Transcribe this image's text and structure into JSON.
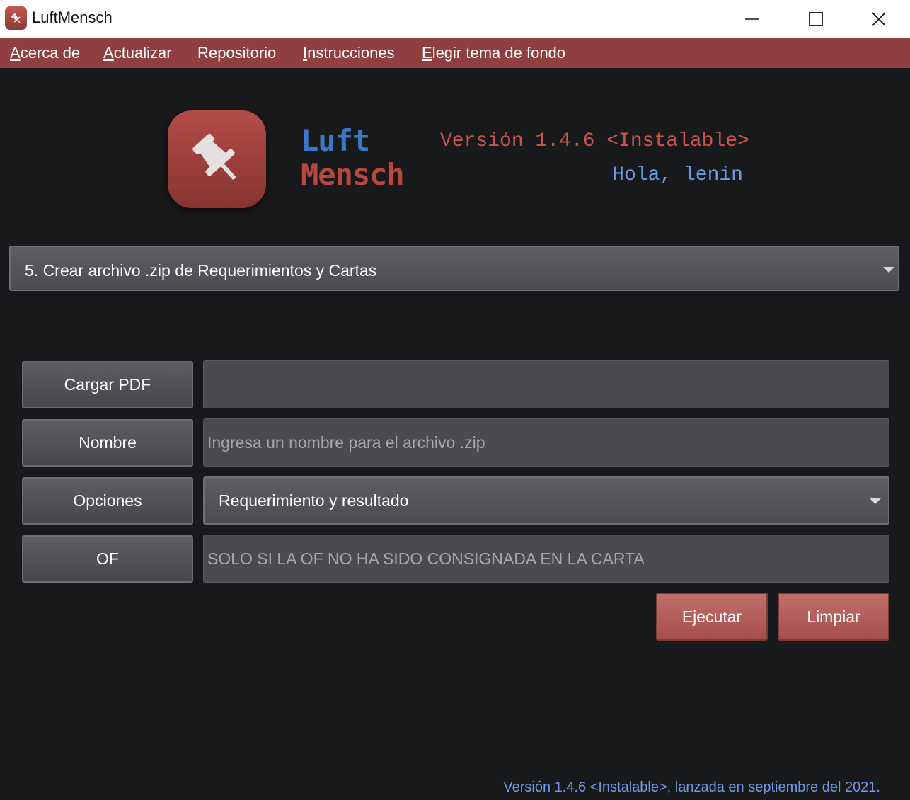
{
  "window": {
    "title": "LuftMensch",
    "icon": "luftmensch-app-icon",
    "controls": [
      "minimize-icon",
      "maximize-icon",
      "close-icon"
    ]
  },
  "menu": {
    "items": [
      {
        "label": "Acerca de",
        "mnemonic": "A",
        "rest": "cerca de"
      },
      {
        "label": "Actualizar",
        "mnemonic": "A",
        "rest": "ctualizar"
      },
      {
        "label": "Repositorio",
        "mnemonic": "",
        "rest": "Repositorio"
      },
      {
        "label": "Instrucciones",
        "mnemonic": "I",
        "rest": "nstrucciones"
      },
      {
        "label": "Elegir tema de fondo",
        "mnemonic": "E",
        "rest": "legir tema de fondo"
      }
    ]
  },
  "header": {
    "logo_word1": "Luft",
    "logo_word2": "Mensch",
    "version": "Versión 1.4.6 <Instalable>",
    "greeting": "Hola, lenin"
  },
  "task_select": {
    "value": "5. Crear archivo .zip de Requerimientos y Cartas"
  },
  "form": {
    "load_pdf": {
      "label": "Cargar PDF",
      "value": ""
    },
    "name": {
      "label": "Nombre",
      "placeholder": "Ingresa un nombre para el archivo .zip"
    },
    "options": {
      "label": "Opciones",
      "value": "Requerimiento y resultado"
    },
    "of": {
      "label": "OF",
      "placeholder": "SOLO SI LA OF NO HA SIDO CONSIGNADA EN LA CARTA"
    }
  },
  "actions": {
    "run": "Ejecutar",
    "clear": "Limpiar"
  },
  "colors": {
    "accent": "#8f3f3f",
    "background": "#18191b",
    "blue_text": "#6e9ae6",
    "red_text": "#c8554f"
  },
  "footer": {
    "text": "Versión 1.4.6 <Instalable>, lanzada en septiembre del 2021."
  }
}
